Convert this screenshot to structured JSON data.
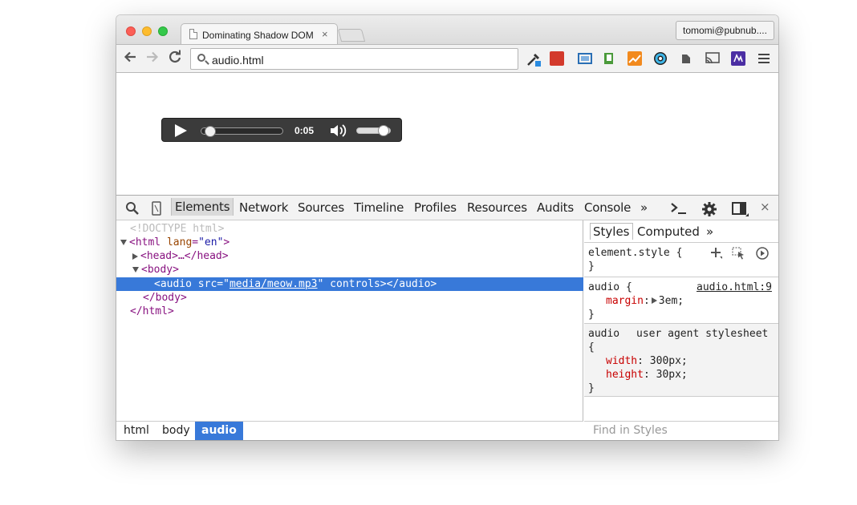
{
  "browser": {
    "tab_title": "Dominating Shadow DOM",
    "tab_close": "×",
    "profile": "tomomi@pubnub....",
    "url": "audio.html"
  },
  "audio_player": {
    "time": "0:05",
    "progress": 0.05,
    "volume": 0.9
  },
  "devtools": {
    "tabs": [
      "Elements",
      "Network",
      "Sources",
      "Timeline",
      "Profiles",
      "Resources",
      "Audits",
      "Console"
    ],
    "active_tab": "Elements",
    "overflow": "»",
    "close": "×",
    "dom": {
      "doctype": "<!DOCTYPE html>",
      "html_open_tag": "<html",
      "html_attr": "lang",
      "html_attr_val": "\"en\"",
      "html_open_end": ">",
      "head": "<head>…</head>",
      "body_open": "<body>",
      "audio_open": "<audio",
      "audio_attr": "src",
      "audio_eq": "=\"",
      "audio_src": "media/meow.mp3",
      "audio_close_quote": "\"",
      "audio_attr2": "controls",
      "audio_end": "></audio>",
      "body_close": "</body>",
      "html_close": "</html>"
    },
    "breadcrumbs": [
      "html",
      "body",
      "audio"
    ],
    "styles": {
      "tabs": [
        "Styles",
        "Computed"
      ],
      "overflow": "»",
      "element_style": "element.style {",
      "close_brace": "}",
      "audio_selector": "audio {",
      "audio_source": "audio.html:9",
      "margin_prop": "margin",
      "margin_val": "3em;",
      "ua_selector": "audio",
      "ua_source": "user agent stylesheet",
      "open_brace": "{",
      "width_prop": "width",
      "width_val": "300px;",
      "height_prop": "height",
      "height_val": "30px;",
      "find_placeholder": "Find in Styles"
    }
  },
  "colors": {
    "selection": "#3879d9",
    "tag": "#881280",
    "attr": "#994500",
    "value": "#1a1aa6",
    "css_prop": "#c80000"
  }
}
